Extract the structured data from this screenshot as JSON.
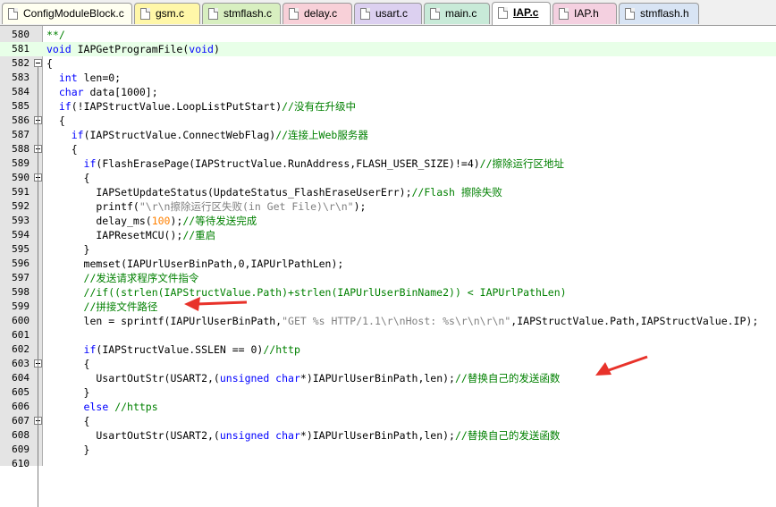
{
  "tabs": [
    {
      "label": "ConfigModuleBlock.c",
      "color": "#fffff0",
      "active": false
    },
    {
      "label": "gsm.c",
      "color": "#fff7a8",
      "active": false
    },
    {
      "label": "stmflash.c",
      "color": "#d8efc0",
      "active": false
    },
    {
      "label": "delay.c",
      "color": "#f8d0d8",
      "active": false
    },
    {
      "label": "usart.c",
      "color": "#dcd0f0",
      "active": false
    },
    {
      "label": "main.c",
      "color": "#c8ead8",
      "active": false
    },
    {
      "label": "IAP.c",
      "color": "#ffffff",
      "active": true
    },
    {
      "label": "IAP.h",
      "color": "#f4d0e0",
      "active": false
    },
    {
      "label": "stmflash.h",
      "color": "#d8e4f4",
      "active": false
    }
  ],
  "lines": [
    {
      "num": "580",
      "fold": false,
      "current": false,
      "parts": [
        {
          "t": "c",
          "v": "**/"
        }
      ]
    },
    {
      "num": "581",
      "fold": false,
      "current": true,
      "parts": [
        {
          "t": "k",
          "v": "void"
        },
        {
          "t": "p",
          "v": " IAPGetProgramFile("
        },
        {
          "t": "k",
          "v": "void"
        },
        {
          "t": "p",
          "v": ")"
        }
      ]
    },
    {
      "num": "582",
      "fold": true,
      "current": false,
      "parts": [
        {
          "t": "p",
          "v": "{"
        }
      ]
    },
    {
      "num": "583",
      "fold": false,
      "current": false,
      "parts": [
        {
          "t": "p",
          "v": "  "
        },
        {
          "t": "k",
          "v": "int"
        },
        {
          "t": "p",
          "v": " len=0;"
        }
      ]
    },
    {
      "num": "584",
      "fold": false,
      "current": false,
      "parts": [
        {
          "t": "p",
          "v": "  "
        },
        {
          "t": "k",
          "v": "char"
        },
        {
          "t": "p",
          "v": " data[1000];"
        }
      ]
    },
    {
      "num": "585",
      "fold": false,
      "current": false,
      "parts": [
        {
          "t": "p",
          "v": "  "
        },
        {
          "t": "k",
          "v": "if"
        },
        {
          "t": "p",
          "v": "(!IAPStructValue.LoopListPutStart)"
        },
        {
          "t": "c",
          "v": "//没有在升级中"
        }
      ]
    },
    {
      "num": "586",
      "fold": true,
      "current": false,
      "parts": [
        {
          "t": "p",
          "v": "  {"
        }
      ]
    },
    {
      "num": "587",
      "fold": false,
      "current": false,
      "parts": [
        {
          "t": "p",
          "v": "    "
        },
        {
          "t": "k",
          "v": "if"
        },
        {
          "t": "p",
          "v": "(IAPStructValue.ConnectWebFlag)"
        },
        {
          "t": "c",
          "v": "//连接上Web服务器"
        }
      ]
    },
    {
      "num": "588",
      "fold": true,
      "current": false,
      "parts": [
        {
          "t": "p",
          "v": "    {"
        }
      ]
    },
    {
      "num": "589",
      "fold": false,
      "current": false,
      "parts": [
        {
          "t": "p",
          "v": "      "
        },
        {
          "t": "k",
          "v": "if"
        },
        {
          "t": "p",
          "v": "(FlashErasePage(IAPStructValue.RunAddress,FLASH_USER_SIZE)!=4)"
        },
        {
          "t": "c",
          "v": "//擦除运行区地址"
        }
      ]
    },
    {
      "num": "590",
      "fold": true,
      "current": false,
      "parts": [
        {
          "t": "p",
          "v": "      {"
        }
      ]
    },
    {
      "num": "591",
      "fold": false,
      "current": false,
      "parts": [
        {
          "t": "p",
          "v": "        IAPSetUpdateStatus(UpdateStatus_FlashEraseUserErr);"
        },
        {
          "t": "c",
          "v": "//Flash 擦除失败"
        }
      ]
    },
    {
      "num": "592",
      "fold": false,
      "current": false,
      "parts": [
        {
          "t": "p",
          "v": "        printf("
        },
        {
          "t": "s",
          "v": "\"\\r\\n擦除运行区失败(in Get File)\\r\\n\""
        },
        {
          "t": "p",
          "v": ");"
        }
      ]
    },
    {
      "num": "593",
      "fold": false,
      "current": false,
      "parts": [
        {
          "t": "p",
          "v": "        delay_ms("
        },
        {
          "t": "n",
          "v": "100"
        },
        {
          "t": "p",
          "v": ");"
        },
        {
          "t": "c",
          "v": "//等待发送完成"
        }
      ]
    },
    {
      "num": "594",
      "fold": false,
      "current": false,
      "parts": [
        {
          "t": "p",
          "v": "        IAPResetMCU();"
        },
        {
          "t": "c",
          "v": "//重启"
        }
      ]
    },
    {
      "num": "595",
      "fold": false,
      "current": false,
      "parts": [
        {
          "t": "p",
          "v": "      }"
        }
      ]
    },
    {
      "num": "596",
      "fold": false,
      "current": false,
      "parts": [
        {
          "t": "p",
          "v": "      memset(IAPUrlUserBinPath,0,IAPUrlPathLen);"
        }
      ]
    },
    {
      "num": "597",
      "fold": false,
      "current": false,
      "parts": [
        {
          "t": "c",
          "v": "      //发送请求程序文件指令"
        }
      ]
    },
    {
      "num": "598",
      "fold": false,
      "current": false,
      "parts": [
        {
          "t": "c",
          "v": "      //if((strlen(IAPStructValue.Path)+strlen(IAPUrlUserBinName2)) < IAPUrlPathLen)"
        }
      ]
    },
    {
      "num": "599",
      "fold": false,
      "current": false,
      "parts": [
        {
          "t": "c",
          "v": "      //拼接文件路径"
        }
      ]
    },
    {
      "num": "600",
      "fold": false,
      "current": false,
      "parts": [
        {
          "t": "p",
          "v": "      len = sprintf(IAPUrlUserBinPath,"
        },
        {
          "t": "s",
          "v": "\"GET %s HTTP/1.1\\r\\nHost: %s\\r\\n\\r\\n\""
        },
        {
          "t": "p",
          "v": ",IAPStructValue.Path,IAPStructValue.IP);"
        }
      ]
    },
    {
      "num": "601",
      "fold": false,
      "current": false,
      "parts": []
    },
    {
      "num": "602",
      "fold": false,
      "current": false,
      "parts": [
        {
          "t": "p",
          "v": "      "
        },
        {
          "t": "k",
          "v": "if"
        },
        {
          "t": "p",
          "v": "(IAPStructValue.SSLEN == 0)"
        },
        {
          "t": "c",
          "v": "//http"
        }
      ]
    },
    {
      "num": "603",
      "fold": true,
      "current": false,
      "parts": [
        {
          "t": "p",
          "v": "      {"
        }
      ]
    },
    {
      "num": "604",
      "fold": false,
      "current": false,
      "parts": [
        {
          "t": "p",
          "v": "        UsartOutStr(USART2,("
        },
        {
          "t": "k",
          "v": "unsigned char"
        },
        {
          "t": "p",
          "v": "*)IAPUrlUserBinPath,len);"
        },
        {
          "t": "c",
          "v": "//替换自己的发送函数"
        }
      ]
    },
    {
      "num": "605",
      "fold": false,
      "current": false,
      "parts": [
        {
          "t": "p",
          "v": "      }"
        }
      ]
    },
    {
      "num": "606",
      "fold": false,
      "current": false,
      "parts": [
        {
          "t": "p",
          "v": "      "
        },
        {
          "t": "k",
          "v": "else"
        },
        {
          "t": "p",
          "v": " "
        },
        {
          "t": "c",
          "v": "//https"
        }
      ]
    },
    {
      "num": "607",
      "fold": true,
      "current": false,
      "parts": [
        {
          "t": "p",
          "v": "      {"
        }
      ]
    },
    {
      "num": "608",
      "fold": false,
      "current": false,
      "parts": [
        {
          "t": "p",
          "v": "        UsartOutStr(USART2,("
        },
        {
          "t": "k",
          "v": "unsigned char"
        },
        {
          "t": "p",
          "v": "*)IAPUrlUserBinPath,len);"
        },
        {
          "t": "c",
          "v": "//替换自己的发送函数"
        }
      ]
    },
    {
      "num": "609",
      "fold": false,
      "current": false,
      "parts": [
        {
          "t": "p",
          "v": "      }"
        }
      ]
    },
    {
      "num": "610",
      "fold": false,
      "current": false,
      "parts": []
    }
  ],
  "annotation_color": "#e8322a"
}
